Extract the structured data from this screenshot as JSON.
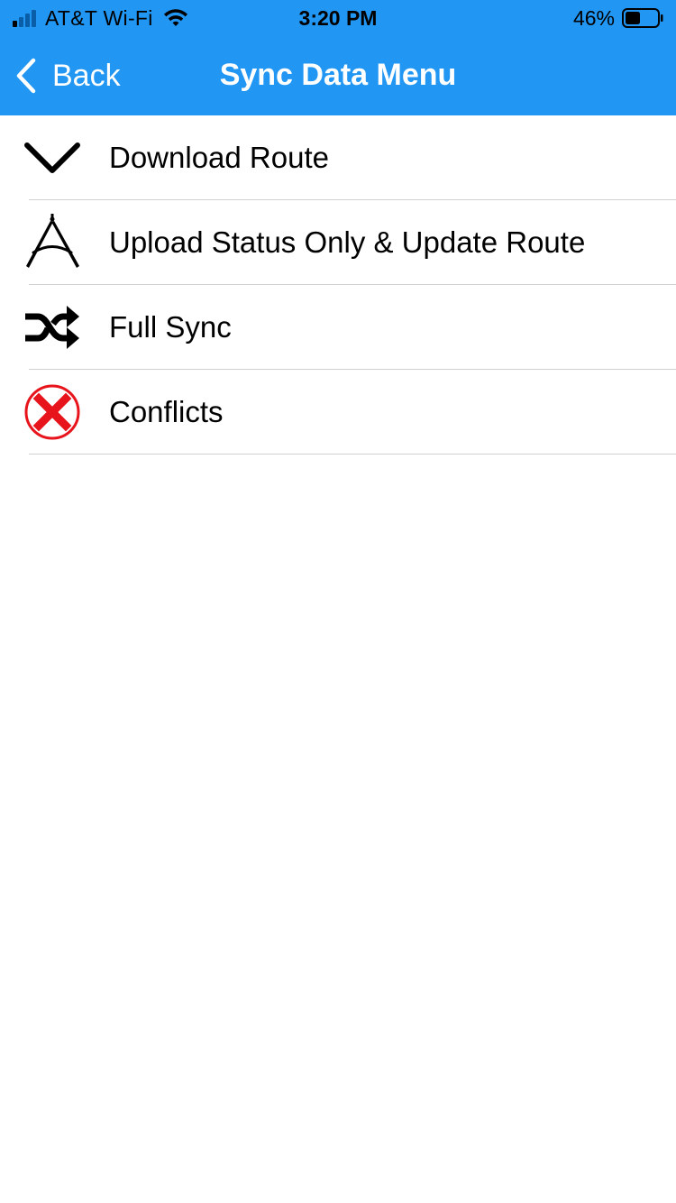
{
  "status_bar": {
    "carrier": "AT&T Wi-Fi",
    "time": "3:20 PM",
    "battery_percent": "46%",
    "signal_icon": "cellular-signal-icon",
    "wifi_icon": "wifi-icon",
    "battery_icon": "battery-icon",
    "battery_level": 0.46,
    "signal_bars_active": 1
  },
  "nav": {
    "back_label": "Back",
    "back_icon": "chevron-left-icon",
    "title": "Sync Data Menu",
    "background_color": "#2196F3"
  },
  "menu": {
    "items": [
      {
        "label": "Download Route",
        "icon": "chevron-down-icon"
      },
      {
        "label": "Upload Status Only & Update Route",
        "icon": "compass-drafting-icon"
      },
      {
        "label": "Full Sync",
        "icon": "shuffle-icon"
      },
      {
        "label": "Conflicts",
        "icon": "red-x-circle-icon",
        "icon_color": "#E8141B"
      }
    ]
  }
}
